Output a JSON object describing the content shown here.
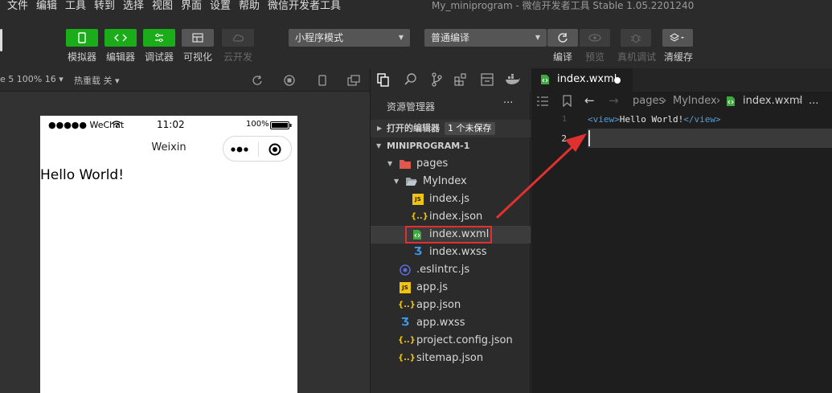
{
  "menu": [
    "文件",
    "编辑",
    "工具",
    "转到",
    "选择",
    "视图",
    "界面",
    "设置",
    "帮助",
    "微信开发者工具"
  ],
  "window_title": "My_miniprogram - 微信开发者工具 Stable 1.05.2201240",
  "toolbar": {
    "simulator": "模拟器",
    "editor": "编辑器",
    "debugger": "调试器",
    "visual": "可视化",
    "cloud": "云开发",
    "mode_select": "小程序模式",
    "compile_select": "普通编译",
    "compile": "编译",
    "preview": "预览",
    "real_debug": "真机调试",
    "clear_cache": "清缓存"
  },
  "simbar": {
    "device": "e 5 100% 16 ▾",
    "hot_reload": "热重载 关 ▾"
  },
  "phone": {
    "signal": "●●●●● WeChat",
    "time": "11:02",
    "battery": "100%",
    "nav_title": "Weixin",
    "content": "Hello World!"
  },
  "explorer": {
    "title": "资源管理器",
    "more": "···",
    "open_editors": "打开的编辑器",
    "unsaved_badge": "1 个未保存",
    "project": "MINIPROGRAM-1",
    "items": [
      {
        "label": "pages"
      },
      {
        "label": "MyIndex"
      },
      {
        "label": "index.js"
      },
      {
        "label": "index.json"
      },
      {
        "label": "index.wxml"
      },
      {
        "label": "index.wxss"
      },
      {
        "label": ".eslintrc.js"
      },
      {
        "label": "app.js"
      },
      {
        "label": "app.json"
      },
      {
        "label": "app.wxss"
      },
      {
        "label": "project.config.json"
      },
      {
        "label": "sitemap.json"
      }
    ]
  },
  "editor": {
    "tab_label": "index.wxml",
    "breadcrumb": [
      "pages",
      "MyIndex",
      "index.wxml"
    ],
    "line1_num": "1",
    "line2_num": "2",
    "code_open_tag": "<view>",
    "code_text": "Hello World!",
    "code_close_tag": "</view>"
  },
  "colors": {
    "accent_green": "#1aad19",
    "highlight_red": "#e03030",
    "tag_blue": "#569cd6"
  }
}
